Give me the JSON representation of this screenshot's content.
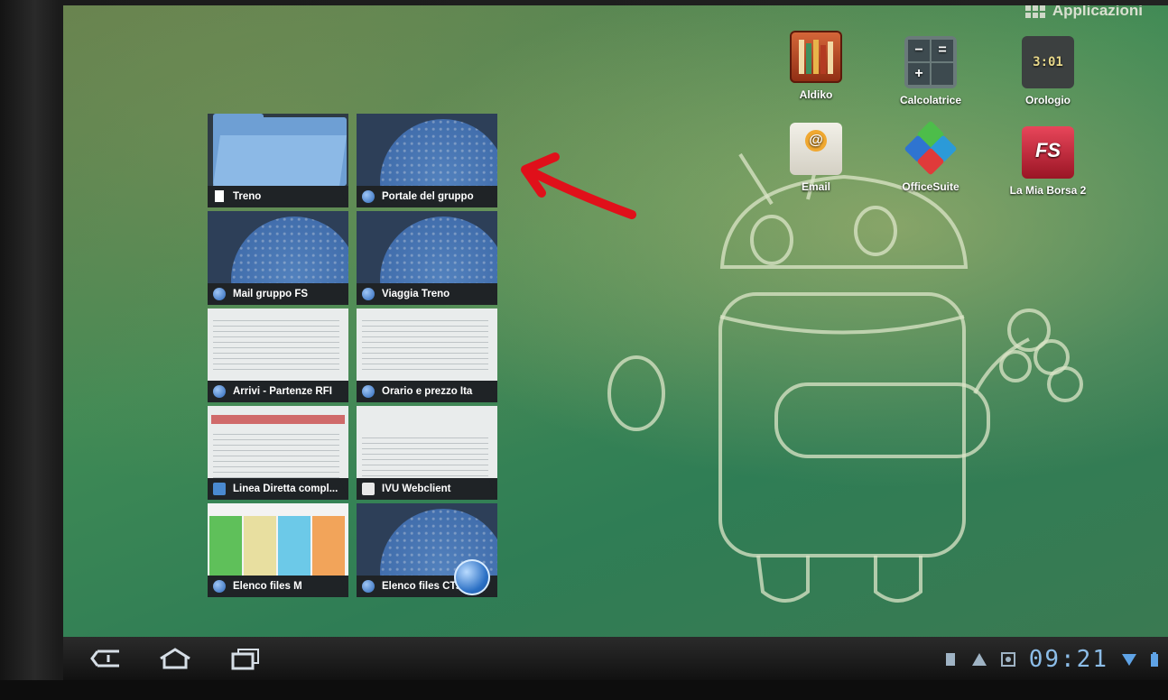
{
  "header": {
    "apps_label": "Applicazioni"
  },
  "shortcuts": [
    {
      "label": "Aldiko",
      "icon": "aldiko-books-icon"
    },
    {
      "label": "Calcolatrice",
      "icon": "calculator-icon"
    },
    {
      "label": "Orologio",
      "icon": "clock-icon",
      "clock_face": "3:01"
    },
    {
      "label": "Email",
      "icon": "email-envelope-icon"
    },
    {
      "label": "OfficeSuite",
      "icon": "officesuite-icon"
    },
    {
      "label": "La Mia Borsa 2",
      "icon": "fs-borsa-icon"
    }
  ],
  "recent_apps": [
    {
      "title": "Treno",
      "icon": "bookmark-icon"
    },
    {
      "title": "Portale del gruppo",
      "icon": "browser-icon"
    },
    {
      "title": "Mail gruppo FS",
      "icon": "browser-icon"
    },
    {
      "title": "Viaggia Treno",
      "icon": "browser-icon"
    },
    {
      "title": "Arrivi - Partenze RFI",
      "icon": "browser-icon"
    },
    {
      "title": "Orario e prezzo Ita",
      "icon": "browser-icon"
    },
    {
      "title": "Linea Diretta compl...",
      "icon": "app-icon"
    },
    {
      "title": "IVU Webclient",
      "icon": "document-icon"
    },
    {
      "title": "Elenco files M",
      "icon": "browser-icon"
    },
    {
      "title": "Elenco files CTsc",
      "icon": "browser-icon"
    }
  ],
  "system_bar": {
    "time": "09:21",
    "nav": [
      "back-icon",
      "home-icon",
      "recent-apps-icon"
    ],
    "status_icons": [
      "sd-card-icon",
      "warning-icon",
      "notification-icon",
      "wifi-icon",
      "battery-icon"
    ]
  },
  "colors": {
    "annotation_arrow": "#e0101a",
    "clock_text": "#8cbde8",
    "caption_bar": "#1f2326"
  }
}
